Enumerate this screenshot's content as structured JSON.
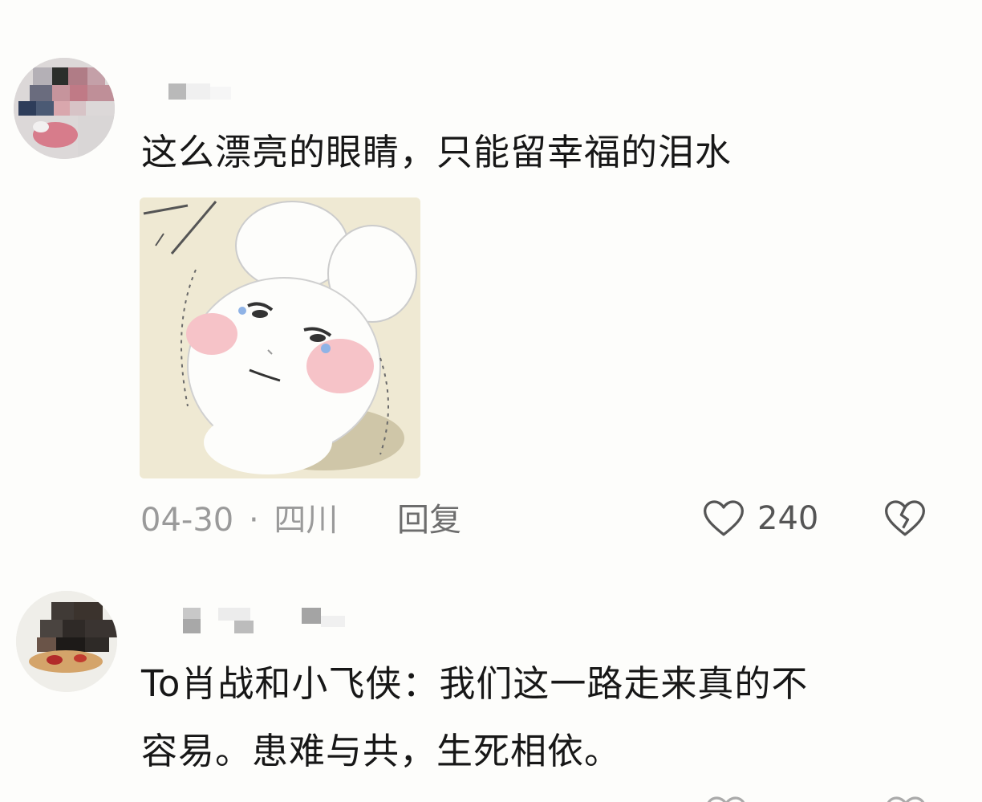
{
  "comments": [
    {
      "text": "这么漂亮的眼睛，只能留幸福的泪水",
      "date": "04-30",
      "separator": "·",
      "location": "四川",
      "reply_label": "回复",
      "like_count": "240",
      "icons": {
        "like": "heart-outline-icon",
        "dislike": "broken-heart-icon"
      },
      "has_sticker": true
    },
    {
      "text_line1": "To肖战和小飞侠：我们这一路走来真的不",
      "text_line2": "容易。患难与共，生死相依。"
    }
  ],
  "colors": {
    "background": "#fdfdfb",
    "text": "#171717",
    "meta": "#9a9a9a",
    "icon": "#555555"
  }
}
